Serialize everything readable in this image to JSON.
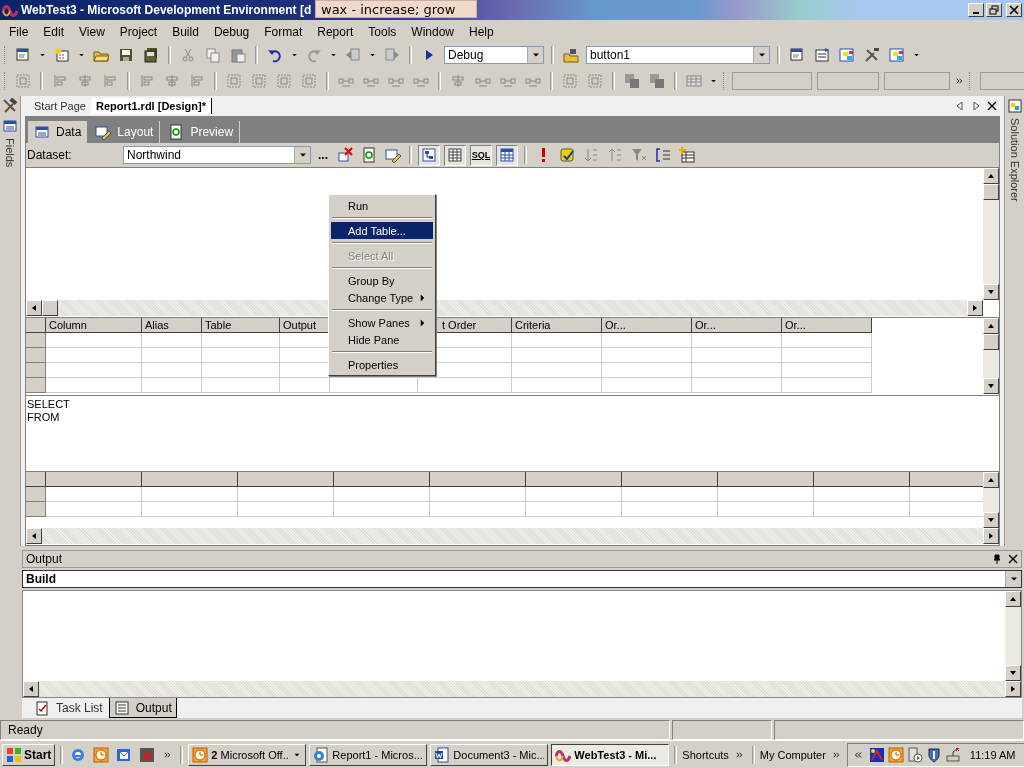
{
  "window": {
    "title": "WebTest3 - Microsoft Development Environment [d"
  },
  "dictionary_tooltip": {
    "text": "wax - increase; grow"
  },
  "menu": [
    "File",
    "Edit",
    "View",
    "Project",
    "Build",
    "Debug",
    "Format",
    "Report",
    "Tools",
    "Window",
    "Help"
  ],
  "toolbar": {
    "configuration": "Debug",
    "object_box": "button1"
  },
  "side_tabs": {
    "left": "Fields",
    "right": "Solution Explorer"
  },
  "document_tabs": [
    {
      "label": "Start Page",
      "selected": false
    },
    {
      "label": "Report1.rdl [Design]*",
      "selected": true
    }
  ],
  "designer_tabs": [
    {
      "label": "Data",
      "selected": true
    },
    {
      "label": "Layout",
      "selected": false
    },
    {
      "label": "Preview",
      "selected": false
    }
  ],
  "dataset": {
    "label": "Dataset:",
    "value": "Northwind",
    "browse": "...",
    "sql_button": "SQL"
  },
  "grid": {
    "columns": [
      {
        "label": "Column"
      },
      {
        "label": "Alias"
      },
      {
        "label": "Table"
      },
      {
        "label": "Output"
      },
      {},
      {
        "label": "t Order"
      },
      {
        "label": "Criteria"
      },
      {
        "label": "Or..."
      },
      {
        "label": "Or..."
      },
      {
        "label": "Or..."
      }
    ]
  },
  "sql_text": [
    "SELECT",
    "FROM"
  ],
  "context_menu": [
    {
      "kind": "item",
      "label": "Run",
      "selected": false,
      "disabled": false,
      "submenu": false
    },
    {
      "kind": "separator"
    },
    {
      "kind": "item",
      "label": "Add Table...",
      "selected": true,
      "disabled": false,
      "submenu": false
    },
    {
      "kind": "separator"
    },
    {
      "kind": "item",
      "label": "Select All",
      "selected": false,
      "disabled": true,
      "submenu": false
    },
    {
      "kind": "separator"
    },
    {
      "kind": "item",
      "label": "Group By",
      "selected": false,
      "disabled": false,
      "submenu": false
    },
    {
      "kind": "item",
      "label": "Change Type",
      "selected": false,
      "disabled": false,
      "submenu": true
    },
    {
      "kind": "separator"
    },
    {
      "kind": "item",
      "label": "Show Panes",
      "selected": false,
      "disabled": false,
      "submenu": true
    },
    {
      "kind": "item",
      "label": "Hide Pane",
      "selected": false,
      "disabled": false,
      "submenu": false
    },
    {
      "kind": "separator"
    },
    {
      "kind": "item",
      "label": "Properties",
      "selected": false,
      "disabled": false,
      "submenu": false
    }
  ],
  "output": {
    "title": "Output",
    "source": "Build",
    "tabs": [
      {
        "label": "Task List",
        "selected": false
      },
      {
        "label": "Output",
        "selected": true
      }
    ]
  },
  "status_bar": {
    "text": "Ready"
  },
  "taskbar": {
    "start": "Start",
    "tasks": [
      {
        "label": "**2** Microsoft Off...",
        "selected": false,
        "group": true
      },
      {
        "label": "Report1 - Micros...",
        "selected": false,
        "group": false
      },
      {
        "label": "Document3 - Mic...",
        "selected": false,
        "group": false
      },
      {
        "label": "WebTest3 - Mi...",
        "selected": true,
        "group": false
      }
    ],
    "toolbars": [
      "Shortcuts",
      "My Computer"
    ],
    "clock": "11:19 AM"
  }
}
